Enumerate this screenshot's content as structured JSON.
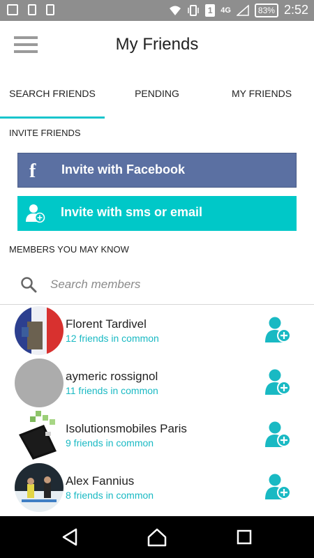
{
  "status": {
    "network": "4G",
    "sim": "1",
    "battery": "83%",
    "time": "2:52"
  },
  "app": {
    "title": "My Friends"
  },
  "tabs": [
    {
      "label": "SEARCH FRIENDS",
      "active": true
    },
    {
      "label": "PENDING",
      "active": false
    },
    {
      "label": "MY FRIENDS",
      "active": false
    }
  ],
  "invite": {
    "section_label": "INVITE FRIENDS",
    "facebook_label": "Invite with Facebook",
    "facebook_icon": "facebook-icon",
    "sms_label": "Invite with sms or email",
    "sms_icon": "add-user-icon"
  },
  "members": {
    "section_label": "MEMBERS YOU MAY KNOW",
    "search_placeholder": "Search members",
    "list": [
      {
        "name": "Florent Tardivel",
        "common": "12 friends in common"
      },
      {
        "name": "aymeric rossignol",
        "common": "11 friends in common"
      },
      {
        "name": "Isolutionsmobiles Paris",
        "common": "9 friends in common"
      },
      {
        "name": "Alex Fannius",
        "common": "8 friends in common"
      }
    ]
  },
  "colors": {
    "accent": "#19c5cc",
    "facebook": "#5b70a2",
    "sms": "#00c8c8"
  }
}
